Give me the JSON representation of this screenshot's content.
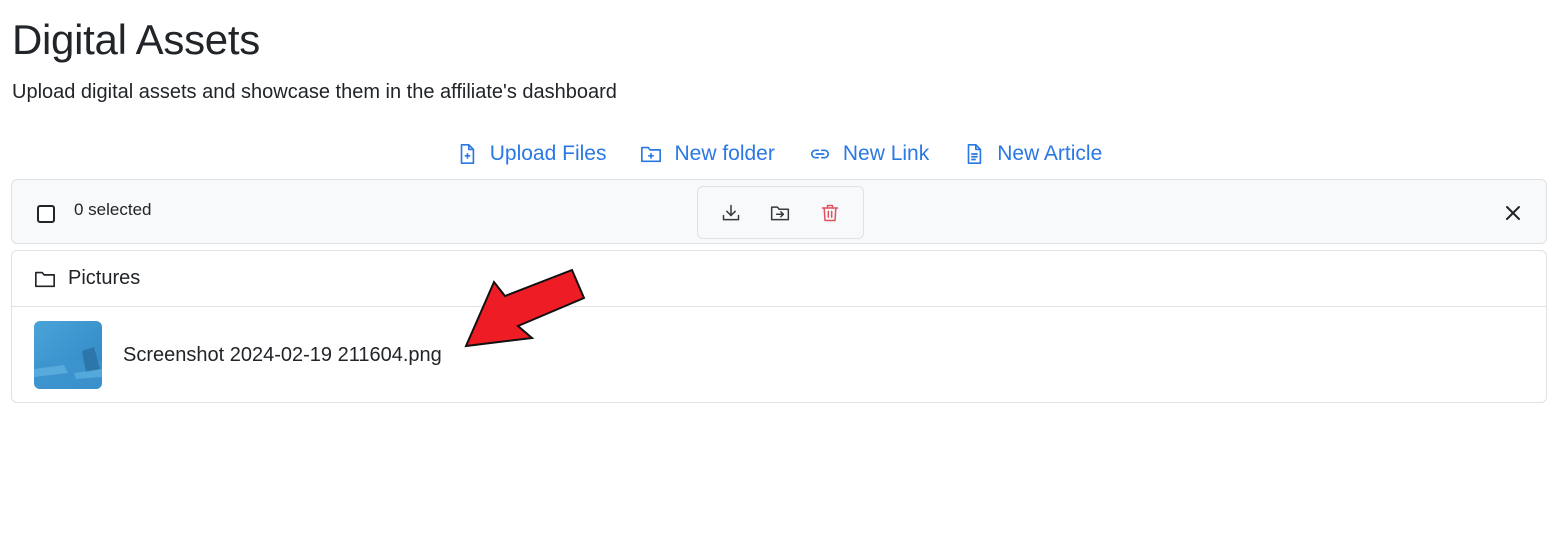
{
  "header": {
    "title": "Digital Assets",
    "subtitle": "Upload digital assets and showcase them in the affiliate's dashboard"
  },
  "actions": [
    {
      "label": "Upload Files",
      "icon": "file-plus-icon"
    },
    {
      "label": "New folder",
      "icon": "folder-plus-icon"
    },
    {
      "label": "New Link",
      "icon": "link-icon"
    },
    {
      "label": "New Article",
      "icon": "file-text-icon"
    }
  ],
  "selection_bar": {
    "count_label": "0 selected",
    "tools": [
      "download-icon",
      "move-to-folder-icon",
      "trash-icon"
    ],
    "close_icon": "close-icon"
  },
  "items": {
    "folder": {
      "name": "Pictures",
      "icon": "folder-icon"
    },
    "file": {
      "name": "Screenshot 2024-02-19 211604.png"
    }
  },
  "colors": {
    "accent": "#2a78e4",
    "danger": "#e05260",
    "arrow": "#ee1c25"
  }
}
